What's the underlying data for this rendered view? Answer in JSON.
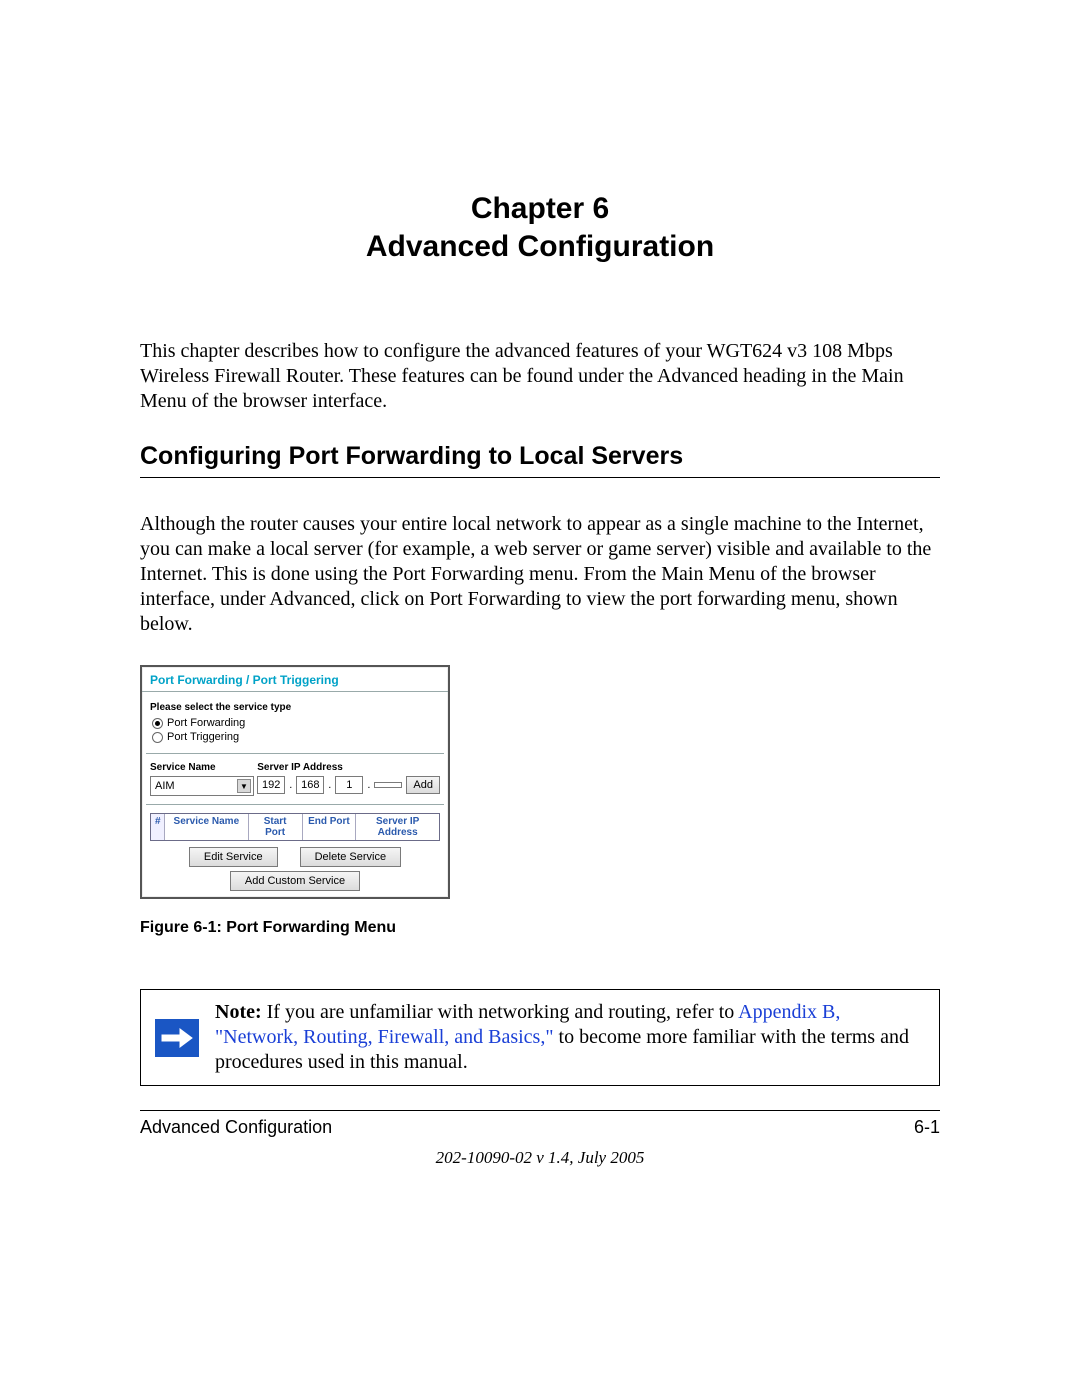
{
  "chapter": {
    "line1": "Chapter 6",
    "line2": "Advanced Configuration"
  },
  "intro": "This chapter describes how to configure the advanced features of your WGT624 v3 108 Mbps Wireless Firewall Router. These features can be found under the Advanced heading in the Main Menu of the browser interface.",
  "section_heading": "Configuring Port Forwarding to Local Servers",
  "section_para": "Although the router causes your entire local network to appear as a single machine to the Internet, you can make a local server (for example, a web server or game server) visible and available to the Internet. This is done using the Port Forwarding menu. From the Main Menu of the browser interface, under Advanced, click on Port Forwarding to view the port forwarding menu, shown below.",
  "panel": {
    "title": "Port Forwarding / Port Triggering",
    "subhead": "Please select the service type",
    "radio_forwarding": "Port Forwarding",
    "radio_triggering": "Port Triggering",
    "service_name_label": "Service Name",
    "server_ip_label": "Server IP Address",
    "service_selected": "AIM",
    "ip": {
      "a": "192",
      "b": "168",
      "c": "1",
      "d": ""
    },
    "add_btn": "Add",
    "th_hash": "#",
    "th_svc": "Service Name",
    "th_start": "Start Port",
    "th_end": "End Port",
    "th_ip": "Server IP Address",
    "edit_btn": "Edit Service",
    "delete_btn": "Delete Service",
    "custom_btn": "Add Custom Service"
  },
  "figure_caption": "Figure 6-1:  Port Forwarding Menu",
  "note": {
    "prefix": "Note:",
    "text1": " If you are unfamiliar with networking and routing, refer to ",
    "link": "Appendix B, \"Network, Routing, Firewall, and Basics,\"",
    "text2": " to become more familiar with the terms and procedures used in this manual."
  },
  "footer": {
    "left": "Advanced Configuration",
    "right": "6-1",
    "meta": "202-10090-02 v 1.4, July 2005"
  }
}
